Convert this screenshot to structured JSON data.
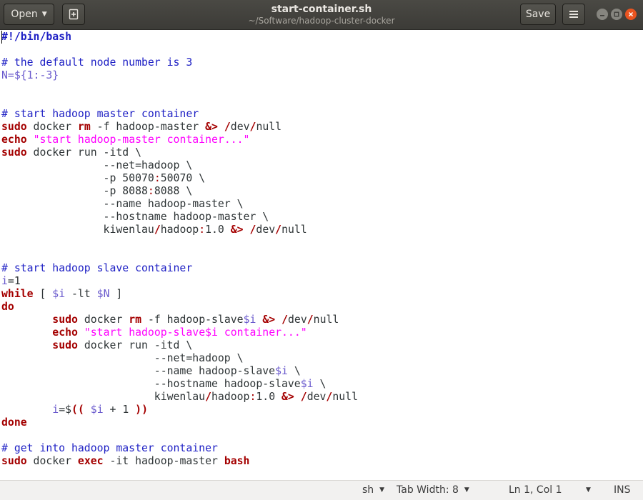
{
  "header": {
    "open_label": "Open",
    "new_tab_icon": "new-document-icon",
    "title": "start-container.sh",
    "subtitle": "~/Software/hadoop-cluster-docker",
    "save_label": "Save",
    "menu_icon": "hamburger-menu-icon",
    "window_controls": [
      "minimize-icon",
      "maximize-icon",
      "close-icon"
    ]
  },
  "editor": {
    "language": "sh",
    "lines": [
      [
        {
          "t": "#!/bin/bash",
          "c": "shebang"
        }
      ],
      [],
      [
        {
          "t": "# the default node number is 3",
          "c": "cmt"
        }
      ],
      [
        {
          "t": "N=${1:-3}",
          "c": "var"
        }
      ],
      [],
      [],
      [
        {
          "t": "# start hadoop master container",
          "c": "cmt"
        }
      ],
      [
        {
          "t": "sudo",
          "c": "kw"
        },
        {
          "t": " docker "
        },
        {
          "t": "rm",
          "c": "kw"
        },
        {
          "t": " -f hadoop-master "
        },
        {
          "t": "&>",
          "c": "op"
        },
        {
          "t": " "
        },
        {
          "t": "/",
          "c": "op"
        },
        {
          "t": "dev"
        },
        {
          "t": "/",
          "c": "op"
        },
        {
          "t": "null"
        }
      ],
      [
        {
          "t": "echo",
          "c": "kw"
        },
        {
          "t": " "
        },
        {
          "t": "\"start hadoop-master container...\"",
          "c": "str"
        }
      ],
      [
        {
          "t": "sudo",
          "c": "kw"
        },
        {
          "t": " docker run -itd \\"
        }
      ],
      [
        {
          "t": "                --net=hadoop \\"
        }
      ],
      [
        {
          "t": "                -p 50070"
        },
        {
          "t": ":",
          "c": "pn"
        },
        {
          "t": "50070 \\"
        }
      ],
      [
        {
          "t": "                -p 8088"
        },
        {
          "t": ":",
          "c": "pn"
        },
        {
          "t": "8088 \\"
        }
      ],
      [
        {
          "t": "                --name hadoop-master \\"
        }
      ],
      [
        {
          "t": "                --hostname hadoop-master \\"
        }
      ],
      [
        {
          "t": "                kiwenlau"
        },
        {
          "t": "/",
          "c": "op"
        },
        {
          "t": "hadoop"
        },
        {
          "t": ":",
          "c": "pn"
        },
        {
          "t": "1.0 "
        },
        {
          "t": "&>",
          "c": "op"
        },
        {
          "t": " "
        },
        {
          "t": "/",
          "c": "op"
        },
        {
          "t": "dev"
        },
        {
          "t": "/",
          "c": "op"
        },
        {
          "t": "null"
        }
      ],
      [],
      [],
      [
        {
          "t": "# start hadoop slave container",
          "c": "cmt"
        }
      ],
      [
        {
          "t": "i",
          "c": "var"
        },
        {
          "t": "=1"
        }
      ],
      [
        {
          "t": "while",
          "c": "kw"
        },
        {
          "t": " [ "
        },
        {
          "t": "$i",
          "c": "var"
        },
        {
          "t": " -lt "
        },
        {
          "t": "$N",
          "c": "var"
        },
        {
          "t": " ]"
        }
      ],
      [
        {
          "t": "do",
          "c": "kw"
        }
      ],
      [
        {
          "t": "        "
        },
        {
          "t": "sudo",
          "c": "kw"
        },
        {
          "t": " docker "
        },
        {
          "t": "rm",
          "c": "kw"
        },
        {
          "t": " -f hadoop-slave"
        },
        {
          "t": "$i",
          "c": "var"
        },
        {
          "t": " "
        },
        {
          "t": "&>",
          "c": "op"
        },
        {
          "t": " "
        },
        {
          "t": "/",
          "c": "op"
        },
        {
          "t": "dev"
        },
        {
          "t": "/",
          "c": "op"
        },
        {
          "t": "null"
        }
      ],
      [
        {
          "t": "        "
        },
        {
          "t": "echo",
          "c": "kw"
        },
        {
          "t": " "
        },
        {
          "t": "\"start hadoop-slave$i container...\"",
          "c": "str"
        }
      ],
      [
        {
          "t": "        "
        },
        {
          "t": "sudo",
          "c": "kw"
        },
        {
          "t": " docker run -itd \\"
        }
      ],
      [
        {
          "t": "                        --net=hadoop \\"
        }
      ],
      [
        {
          "t": "                        --name hadoop-slave"
        },
        {
          "t": "$i",
          "c": "var"
        },
        {
          "t": " \\"
        }
      ],
      [
        {
          "t": "                        --hostname hadoop-slave"
        },
        {
          "t": "$i",
          "c": "var"
        },
        {
          "t": " \\"
        }
      ],
      [
        {
          "t": "                        kiwenlau"
        },
        {
          "t": "/",
          "c": "op"
        },
        {
          "t": "hadoop"
        },
        {
          "t": ":",
          "c": "pn"
        },
        {
          "t": "1.0 "
        },
        {
          "t": "&>",
          "c": "op"
        },
        {
          "t": " "
        },
        {
          "t": "/",
          "c": "op"
        },
        {
          "t": "dev"
        },
        {
          "t": "/",
          "c": "op"
        },
        {
          "t": "null"
        }
      ],
      [
        {
          "t": "        "
        },
        {
          "t": "i",
          "c": "var"
        },
        {
          "t": "=$"
        },
        {
          "t": "((",
          "c": "op"
        },
        {
          "t": " "
        },
        {
          "t": "$i",
          "c": "var"
        },
        {
          "t": " + 1 "
        },
        {
          "t": "))",
          "c": "op"
        }
      ],
      [
        {
          "t": "done",
          "c": "kw"
        }
      ],
      [],
      [
        {
          "t": "# get into hadoop master container",
          "c": "cmt"
        }
      ],
      [
        {
          "t": "sudo",
          "c": "kw"
        },
        {
          "t": " docker "
        },
        {
          "t": "exec",
          "c": "kw"
        },
        {
          "t": " -it hadoop-master "
        },
        {
          "t": "bash",
          "c": "kw"
        }
      ]
    ]
  },
  "statusbar": {
    "language": "sh",
    "tab_width": "Tab Width: 8",
    "position": "Ln 1, Col 1",
    "mode": "INS"
  }
}
